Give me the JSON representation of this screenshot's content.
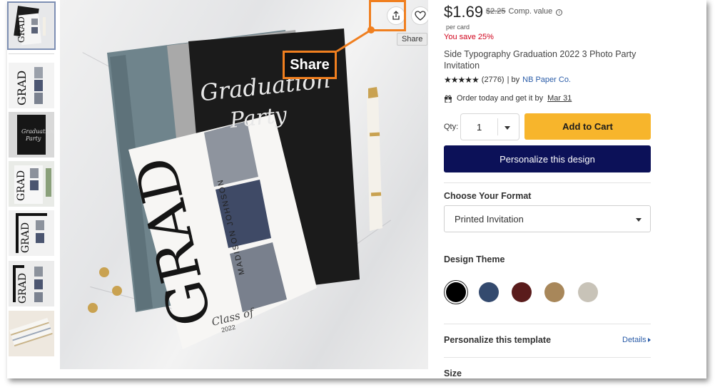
{
  "thumbnails": [
    {
      "name": "thumb-1",
      "bg": "#f4f4f4",
      "accent": "#222222",
      "selected": true
    },
    {
      "name": "thumb-2",
      "bg": "#f3f3f3",
      "accent": "#222222",
      "selected": false
    },
    {
      "name": "thumb-3",
      "bg": "#1a1a1a",
      "accent": "#cccccc",
      "selected": false
    },
    {
      "name": "thumb-4",
      "bg": "#f1f1f1",
      "accent": "#333333",
      "selected": false
    },
    {
      "name": "thumb-5",
      "bg": "#f7f7f7",
      "accent": "#111111",
      "selected": false
    },
    {
      "name": "thumb-6",
      "bg": "#eeeeee",
      "accent": "#222222",
      "selected": false
    },
    {
      "name": "thumb-7",
      "bg": "#e8e4dd",
      "accent": "#b9a47b",
      "selected": false
    }
  ],
  "photo": {
    "share_icon": "share-icon",
    "heart_icon": "heart-icon",
    "tooltip": "Share",
    "callout_label": "Share",
    "callout_color": "#f07f1f",
    "card": {
      "big_text": "GRAD",
      "name_text": "MADISON JOHNSON",
      "class_text": "Class of",
      "year_text": "2022",
      "script_line1": "Graduation",
      "script_line2": "Party"
    }
  },
  "product": {
    "price": "$1.69",
    "comp_price": "$2.25",
    "comp_label": "Comp. value",
    "per_unit": "per card",
    "savings": "You save 25%",
    "title": "Side Typography Graduation 2022 3 Photo Party Invitation",
    "stars": "★★★★★",
    "rating_count": "(2776)",
    "by_label": "| by",
    "brand": "NB Paper Co.",
    "order_text": "Order today and get it by",
    "order_date": "Mar 31",
    "qty_label": "Qty:",
    "qty_value": "1",
    "add_to_cart": "Add to Cart",
    "personalize_button": "Personalize this design",
    "format_heading": "Choose Your Format",
    "format_value": "Printed Invitation",
    "theme_heading": "Design Theme",
    "theme_colors": [
      "#000000",
      "#344a6e",
      "#5a1c1c",
      "#a8875a",
      "#c8c3b8"
    ],
    "template_heading": "Personalize this template",
    "details_link": "Details",
    "size_heading": "Size"
  },
  "colors": {
    "add_to_cart": "#f7b52c",
    "personalize": "#0c1158",
    "savings": "#d0021b",
    "link": "#2a5ca8"
  }
}
